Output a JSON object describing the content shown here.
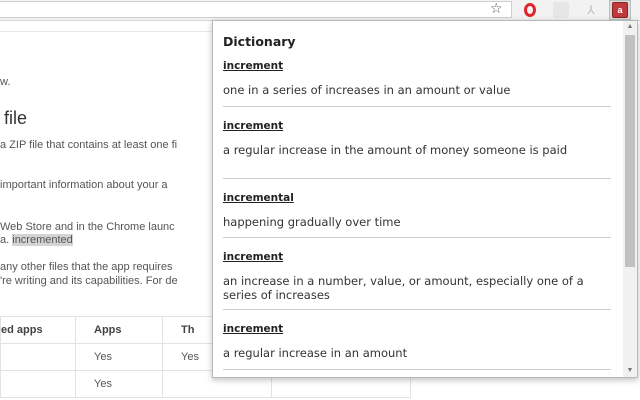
{
  "toolbar": {
    "bookmark_icon": "star-icon",
    "extensions": [
      "opera-icon",
      "extension-icon",
      "pdf-icon",
      "dictionary-extension-icon"
    ]
  },
  "page": {
    "line1": "w.",
    "heading": "file",
    "line2": "a ZIP file that contains at least one fi",
    "line3": "important information about your a",
    "line4": "Web Store and in the Chrome launc",
    "line5_prefix": "a.",
    "line5_highlight": "incremented",
    "line6": "any other files that the app requires",
    "line7": "'re writing and its capabilities. For de",
    "table": {
      "headers": [
        "ed apps",
        "Apps",
        "Th"
      ],
      "rows": [
        [
          "",
          "Yes",
          "Yes"
        ],
        [
          "",
          "Yes",
          ""
        ]
      ]
    }
  },
  "popup": {
    "title": "Dictionary",
    "entries": [
      {
        "word": "increment",
        "definition": "one in a series of increases in an amount or value"
      },
      {
        "word": "increment",
        "definition": "a regular increase in the amount of money someone is paid"
      },
      {
        "word": "incremental",
        "definition": "happening gradually over time"
      },
      {
        "word": "increment",
        "definition": "an increase in a number, value, or amount, especially one of a series of increases"
      },
      {
        "word": "increment",
        "definition": "a regular increase in an amount"
      }
    ]
  }
}
